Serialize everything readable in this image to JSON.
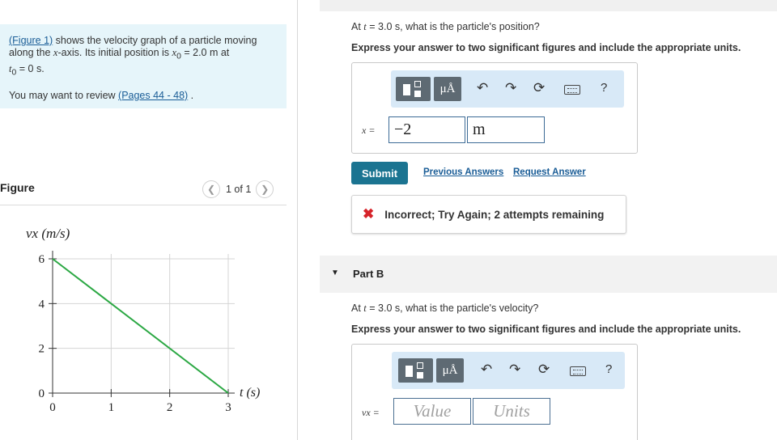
{
  "intro": {
    "figure_link": "(Figure 1)",
    "text_before_x": " shows the velocity graph of a particle moving along the ",
    "axis_var": "x",
    "text_mid": "-axis. Its initial position is ",
    "x0_var": "x",
    "x0_sub": "0",
    "x0_value": " = 2.0 m at",
    "t0_var": "t",
    "t0_sub": "0",
    "t0_value": " = 0 s.",
    "review_prefix": "You may want to review ",
    "review_link": "(Pages 44 - 48)",
    "review_suffix": " ."
  },
  "figure": {
    "title": "Figure",
    "pager_text": "1 of 1",
    "prev_icon": "chevron-left-icon",
    "next_icon": "chevron-right-icon"
  },
  "chart_data": {
    "type": "line",
    "ylabel": "vx (m/s)",
    "xlabel": "t (s)",
    "x_ticks": [
      "0",
      "1",
      "2",
      "3"
    ],
    "y_ticks": [
      "0",
      "2",
      "4",
      "6"
    ],
    "xlim": [
      0,
      3
    ],
    "ylim": [
      0,
      6
    ],
    "grid": true,
    "series": [
      {
        "x": [
          0,
          3
        ],
        "y": [
          6,
          0
        ],
        "color": "#2ca844"
      }
    ]
  },
  "part_a": {
    "question_prefix": "At ",
    "question_var": "t",
    "question_suffix": " = 3.0 s, what is the particle's position?",
    "instructions": "Express your answer to two significant figures and include the appropriate units.",
    "var_label": "x =",
    "value": "−2",
    "units": "m",
    "submit_label": "Submit",
    "previous_answers_label": "Previous Answers",
    "request_answer_label": "Request Answer",
    "feedback_icon": "x-icon",
    "feedback": "Incorrect; Try Again; 2 attempts remaining"
  },
  "toolbar": {
    "units_label": "μÅ",
    "help_label": "?",
    "icons": [
      "fraction-templates-icon",
      "units-icon",
      "undo-icon",
      "redo-icon",
      "reset-icon",
      "keyboard-icon",
      "help-icon"
    ]
  },
  "part_b": {
    "header": "Part B",
    "question_prefix": "At ",
    "question_var": "t",
    "question_suffix": " = 3.0 s, what is the particle's velocity?",
    "instructions": "Express your answer to two significant figures and include the appropriate units.",
    "var_label": "vx =",
    "value_placeholder": "Value",
    "units_placeholder": "Units"
  },
  "colors": {
    "intro_bg": "#e6f5fa",
    "submit_bg": "#1b7491",
    "toolbar_bg": "#d8e9f7",
    "line": "#2ca844",
    "error": "#d6232a"
  }
}
